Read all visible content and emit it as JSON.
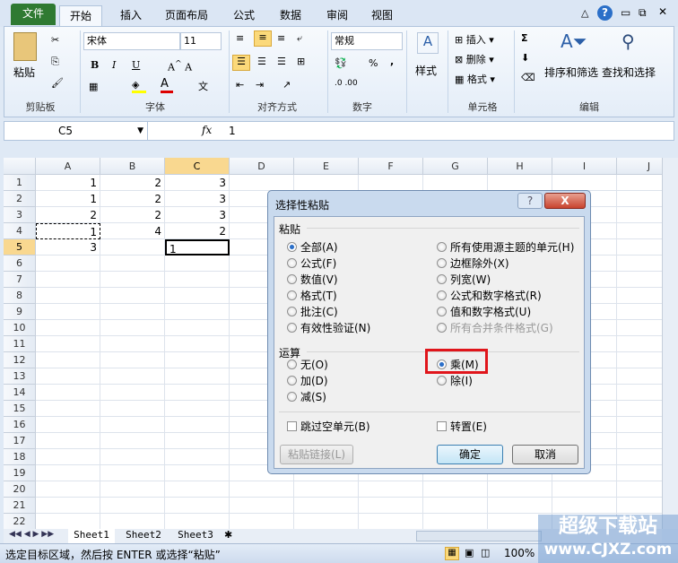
{
  "tabs": [
    "文件",
    "开始",
    "插入",
    "页面布局",
    "公式",
    "数据",
    "审阅",
    "视图"
  ],
  "ribbon": {
    "clipboard": {
      "paste": "粘贴",
      "label": "剪贴板"
    },
    "font": {
      "name": "宋体",
      "size": "11",
      "label": "字体",
      "bold": "B",
      "italic": "I",
      "underline": "U"
    },
    "alignment": {
      "label": "对齐方式"
    },
    "number": {
      "format": "常规",
      "label": "数字",
      "percent": "%",
      "comma": ","
    },
    "styles": {
      "label": "样式"
    },
    "cells": {
      "insert": "插入",
      "delete": "删除",
      "format": "格式",
      "label": "单元格"
    },
    "editing": {
      "sum": "Σ",
      "sort": "排序和筛选",
      "find": "查找和选择",
      "label": "编辑"
    }
  },
  "formula_bar": {
    "name_box": "C5",
    "fx": "fx",
    "value": "1"
  },
  "columns": [
    "A",
    "B",
    "C",
    "D",
    "E",
    "F",
    "G",
    "H",
    "I",
    "J"
  ],
  "rows": [
    "1",
    "2",
    "3",
    "4",
    "5",
    "6",
    "7",
    "8",
    "9",
    "10",
    "11",
    "12",
    "13",
    "14",
    "15",
    "16",
    "17",
    "18",
    "19",
    "20",
    "21",
    "22"
  ],
  "cells": [
    [
      "1",
      "2",
      "3"
    ],
    [
      "1",
      "2",
      "3"
    ],
    [
      "2",
      "2",
      "3"
    ],
    [
      "1",
      "4",
      "2"
    ],
    [
      "3",
      "",
      "1"
    ]
  ],
  "dialog": {
    "title": "选择性粘贴",
    "help": "?",
    "close": "X",
    "paste_label": "粘贴",
    "paste_left": [
      "全部(A)",
      "公式(F)",
      "数值(V)",
      "格式(T)",
      "批注(C)",
      "有效性验证(N)"
    ],
    "paste_right": [
      "所有使用源主题的单元(H)",
      "边框除外(X)",
      "列宽(W)",
      "公式和数字格式(R)",
      "值和数字格式(U)",
      "所有合并条件格式(G)"
    ],
    "op_label": "运算",
    "op_left": [
      "无(O)",
      "加(D)",
      "减(S)"
    ],
    "op_right": [
      "乘(M)",
      "除(I)"
    ],
    "skip_blanks": "跳过空单元(B)",
    "transpose": "转置(E)",
    "paste_link": "粘贴链接(L)",
    "ok": "确定",
    "cancel": "取消",
    "selected_paste": "全部(A)",
    "selected_op": "乘(M)",
    "highlight_color": "#e0151b"
  },
  "sheets": [
    "Sheet1",
    "Sheet2",
    "Sheet3"
  ],
  "status": {
    "message": "选定目标区域，然后按 ENTER 或选择“粘贴”",
    "zoom": "100%"
  },
  "watermark": {
    "line1": "超级下载站",
    "line2": "www.CJXZ.com"
  }
}
